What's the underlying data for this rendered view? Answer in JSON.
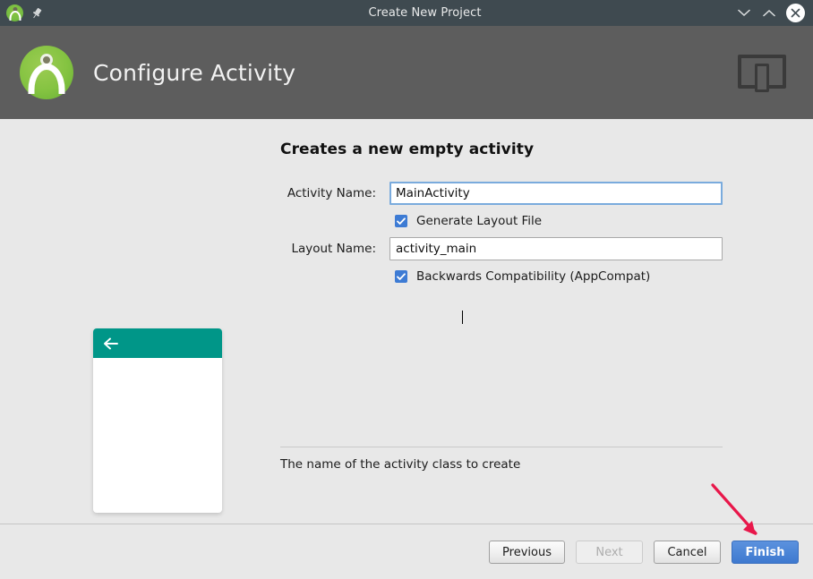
{
  "window": {
    "title": "Create New Project",
    "app_icon": "android-studio-icon",
    "pin_icon": "pin-icon",
    "controls": {
      "minimize": "chevron-down-icon",
      "maximize": "chevron-up-icon",
      "close": "close-icon"
    }
  },
  "header": {
    "title": "Configure Activity",
    "logo": "android-studio-logo",
    "device_icon": "tablet-phone-template-icon"
  },
  "preview": {
    "appbar_color": "#009688",
    "back_icon": "arrow-left-icon"
  },
  "form": {
    "heading": "Creates a new empty activity",
    "activity_name": {
      "label": "Activity Name:",
      "value": "MainActivity",
      "placeholder": ""
    },
    "generate_layout": {
      "label": "Generate Layout File",
      "checked": true
    },
    "layout_name": {
      "label": "Layout Name:",
      "value": "activity_main",
      "placeholder": ""
    },
    "backwards_compat": {
      "label": "Backwards Compatibility (AppCompat)",
      "checked": true
    },
    "help_text": "The name of the activity class to create"
  },
  "footer": {
    "previous": "Previous",
    "next": "Next",
    "cancel": "Cancel",
    "finish": "Finish"
  },
  "annotation": {
    "arrow_color": "#e8174a",
    "target": "finish-button"
  },
  "colors": {
    "titlebar": "#3f4a50",
    "header_band": "#5d5d5d",
    "body": "#e8e8e8",
    "accent_blue": "#4a84d6",
    "checkbox_blue": "#3d7bd4",
    "teal": "#009688"
  }
}
